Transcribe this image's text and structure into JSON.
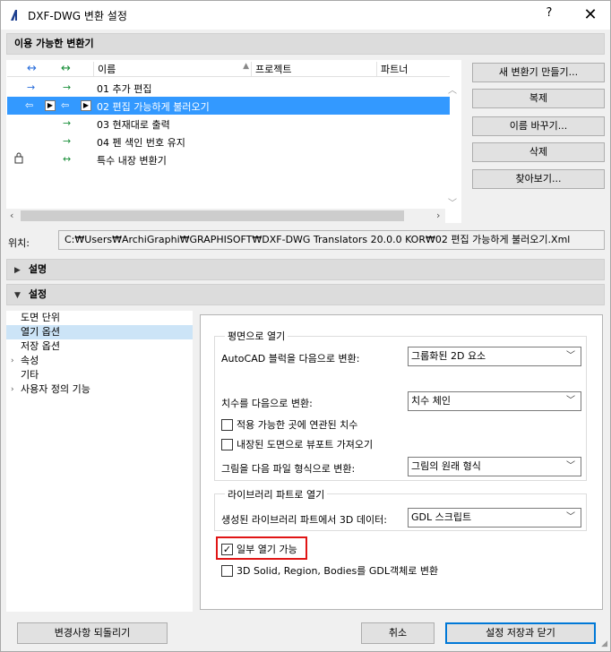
{
  "window": {
    "title": "DXF-DWG 변환 설정",
    "help_label": "?",
    "close_label": "✕"
  },
  "translators_section": {
    "title": "이용 가능한 변환기",
    "columns": [
      "↔",
      "↔",
      "이름",
      "프로젝트",
      "파트너"
    ],
    "rows": [
      {
        "name": "01 추가 편집",
        "icon1": "→",
        "icon2": "→",
        "selected": false
      },
      {
        "name": "02 편집 가능하게 불러오기",
        "icon1": "⇦",
        "icon2": "⇦",
        "selected": true
      },
      {
        "name": "03 현재대로 출력",
        "icon1": "",
        "icon2": "→",
        "selected": false
      },
      {
        "name": "04 펜 색인 번호 유지",
        "icon1": "",
        "icon2": "→",
        "selected": false
      },
      {
        "name": "특수 내장 변환기",
        "icon1": "",
        "icon2": "↔",
        "selected": false
      }
    ],
    "buttons": {
      "new": "새 변환기 만들기...",
      "duplicate": "복제",
      "rename": "이름 바꾸기...",
      "delete": "삭제",
      "browse": "찾아보기..."
    },
    "location_label": "위치:",
    "location_path": "C:₩Users₩ArchiGraphi₩GRAPHISOFT₩DXF-DWG Translators 20.0.0 KOR₩02 편집 가능하게 불러오기.Xml"
  },
  "description_section": {
    "title": "설명"
  },
  "settings_section": {
    "title": "설정",
    "tree": [
      {
        "label": "도면 단위",
        "expandable": false,
        "selected": false
      },
      {
        "label": "열기 옵션",
        "expandable": false,
        "selected": true
      },
      {
        "label": "저장 옵션",
        "expandable": false,
        "selected": false
      },
      {
        "label": "속성",
        "expandable": true,
        "selected": false
      },
      {
        "label": "기타",
        "expandable": false,
        "selected": false
      },
      {
        "label": "사용자 정의 기능",
        "expandable": true,
        "selected": false
      }
    ],
    "plan_group": {
      "title": "평면으로 열기",
      "autocad_block_label": "AutoCAD 블럭을 다음으로 변환:",
      "autocad_block_value": "그룹화된 2D 요소",
      "dimension_label": "치수를 다음으로 변환:",
      "dimension_value": "치수 체인",
      "assoc_dim_label": "적용 가능한 곳에 연관된 치수",
      "import_views_label": "내장된 도면으로 뷰포트 가져오기",
      "image_label": "그림을 다음 파일 형식으로 변환:",
      "image_value": "그림의 원래 형식"
    },
    "library_group": {
      "title": "라이브러리 파트로 열기",
      "data_3d_label": "생성된 라이브러리 파트에서 3D 데이터:",
      "data_3d_value": "GDL 스크립트"
    },
    "partial_open_label": "일부 열기 가능",
    "partial_open_checked": true,
    "solid_convert_label": "3D Solid, Region, Bodies를 GDL객체로 변환",
    "solid_convert_checked": false
  },
  "footer": {
    "revert": "변경사항 되돌리기",
    "cancel": "취소",
    "save_close": "설정 저장과 닫기"
  }
}
